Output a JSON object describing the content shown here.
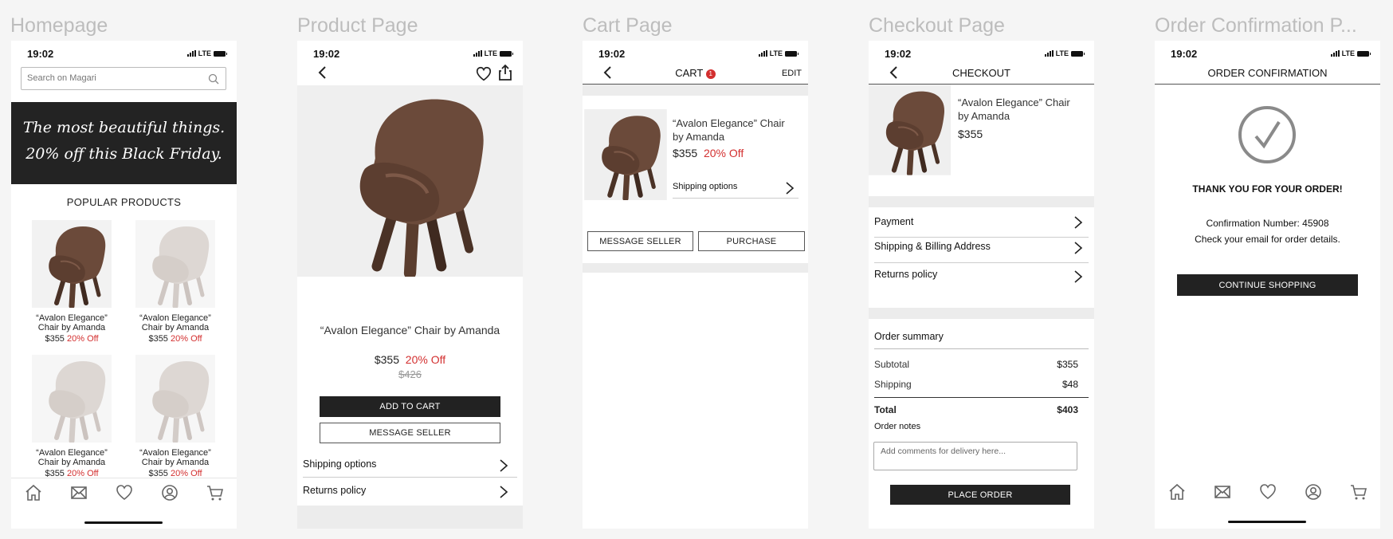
{
  "frames": {
    "home_title": "Homepage",
    "product_title": "Product Page",
    "cart_title": "Cart Page",
    "checkout_title": "Checkout Page",
    "confirm_title": "Order Confirmation P..."
  },
  "status": {
    "time": "19:02",
    "network": "LTE"
  },
  "colors": {
    "accent_red": "#d32f2f",
    "dark_button": "#222222",
    "chair_brown": "#6b4a3a",
    "faded_chair": "#d8d2cf"
  },
  "home": {
    "search_placeholder": "Search on Magari",
    "banner_line1": "The most beautiful things.",
    "banner_line2": "20% off this Black Friday.",
    "section_title": "POPULAR PRODUCTS",
    "products": [
      {
        "name1": "“Avalon Elegance”",
        "name2": "Chair by Amanda",
        "price": "$355",
        "discount": "20% Off"
      },
      {
        "name1": "“Avalon Elegance”",
        "name2": "Chair by Amanda",
        "price": "$355",
        "discount": "20% Off"
      },
      {
        "name1": "“Avalon Elegance”",
        "name2": "Chair by Amanda",
        "price": "$355",
        "discount": "20% Off"
      },
      {
        "name1": "“Avalon Elegance”",
        "name2": "Chair by Amanda",
        "price": "$355",
        "discount": "20% Off"
      }
    ]
  },
  "product": {
    "title": "“Avalon Elegance” Chair by Amanda",
    "price": "$355",
    "discount": "20% Off",
    "old_price": "$426",
    "add_to_cart": "ADD TO CART",
    "message_seller": "MESSAGE SELLER",
    "shipping_options": "Shipping options",
    "returns_policy": "Returns policy"
  },
  "cart": {
    "title": "CART",
    "badge_count": "1",
    "edit": "EDIT",
    "item_name1": "“Avalon Elegance” Chair",
    "item_name2": "by Amanda",
    "price": "$355",
    "discount": "20% Off",
    "shipping_options": "Shipping options",
    "message_seller": "MESSAGE SELLER",
    "purchase": "PURCHASE"
  },
  "checkout": {
    "title": "CHECKOUT",
    "item_name1": "“Avalon Elegance” Chair",
    "item_name2": "by Amanda",
    "price": "$355",
    "payment": "Payment",
    "shipping_billing": "Shipping & Billing Address",
    "returns_policy": "Returns policy",
    "summary_title": "Order summary",
    "subtotal_label": "Subtotal",
    "subtotal_value": "$355",
    "shipping_label": "Shipping",
    "shipping_value": "$48",
    "total_label": "Total",
    "total_value": "$403",
    "notes_label": "Order notes",
    "notes_placeholder": "Add comments for delivery here...",
    "place_order": "PLACE ORDER"
  },
  "confirm": {
    "title": "ORDER CONFIRMATION",
    "thank_you": "THANK YOU FOR YOUR ORDER!",
    "confirmation_line": "Confirmation Number: 45908",
    "email_line": "Check your email for order details.",
    "continue": "CONTINUE SHOPPING"
  },
  "tabbar_icons": [
    "home-icon",
    "mail-icon",
    "heart-icon",
    "profile-icon",
    "cart-icon"
  ]
}
